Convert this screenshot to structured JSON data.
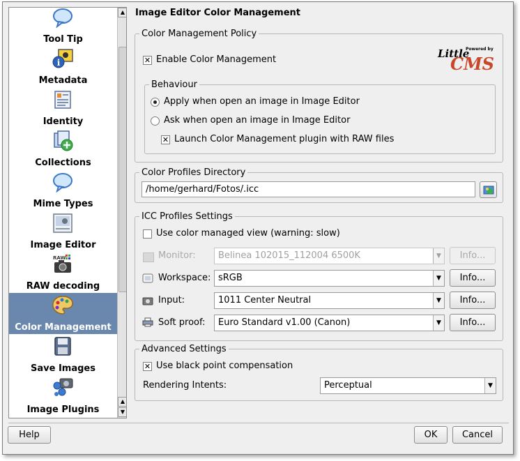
{
  "sidebar": {
    "items": [
      {
        "label": "Tool Tip",
        "icon": "speech-bubble-icon"
      },
      {
        "label": "Metadata",
        "icon": "info-photo-icon"
      },
      {
        "label": "Identity",
        "icon": "identity-card-icon"
      },
      {
        "label": "Collections",
        "icon": "collections-icon"
      },
      {
        "label": "Mime Types",
        "icon": "speech-bubble-icon"
      },
      {
        "label": "Image Editor",
        "icon": "image-editor-icon"
      },
      {
        "label": "RAW decoding",
        "icon": "raw-camera-icon"
      },
      {
        "label": "Color Management",
        "icon": "palette-icon"
      },
      {
        "label": "Save Images",
        "icon": "floppy-disk-icon"
      },
      {
        "label": "Image Plugins",
        "icon": "plugins-icon"
      }
    ],
    "selected_index": 7,
    "selected_color": "#6a88ad"
  },
  "page": {
    "title": "Image Editor Color Management"
  },
  "policy": {
    "legend": "Color Management Policy",
    "enable_label": "Enable Color Management",
    "enable_checked": true,
    "logo_powered": "Powered by",
    "logo_little": "Little",
    "logo_cms": "CMS",
    "behaviour": {
      "legend": "Behaviour",
      "apply_label": "Apply when open an image in Image Editor",
      "ask_label": "Ask when open an image in Image Editor",
      "launch_label": "Launch Color Management plugin with RAW files",
      "selected": "apply",
      "launch_checked": true
    }
  },
  "profiles_dir": {
    "legend": "Color Profiles Directory",
    "path": "/home/gerhard/Fotos/.icc"
  },
  "icc": {
    "legend": "ICC Profiles Settings",
    "managed_view_label": "Use color managed view (warning: slow)",
    "managed_view_checked": false,
    "monitor_label": "Monitor:",
    "monitor_value": "Belinea 102015_112004 6500K",
    "workspace_label": "Workspace:",
    "workspace_value": "sRGB",
    "input_label": "Input:",
    "input_value": "1011 Center Neutral",
    "softproof_label": "Soft proof:",
    "softproof_value": "Euro Standard v1.00 (Canon)",
    "info_label": "Info..."
  },
  "advanced": {
    "legend": "Advanced Settings",
    "bpc_label": "Use black point compensation",
    "bpc_checked": true,
    "intent_label": "Rendering Intents:",
    "intent_value": "Perceptual"
  },
  "footer": {
    "help": "Help",
    "ok": "OK",
    "cancel": "Cancel"
  }
}
